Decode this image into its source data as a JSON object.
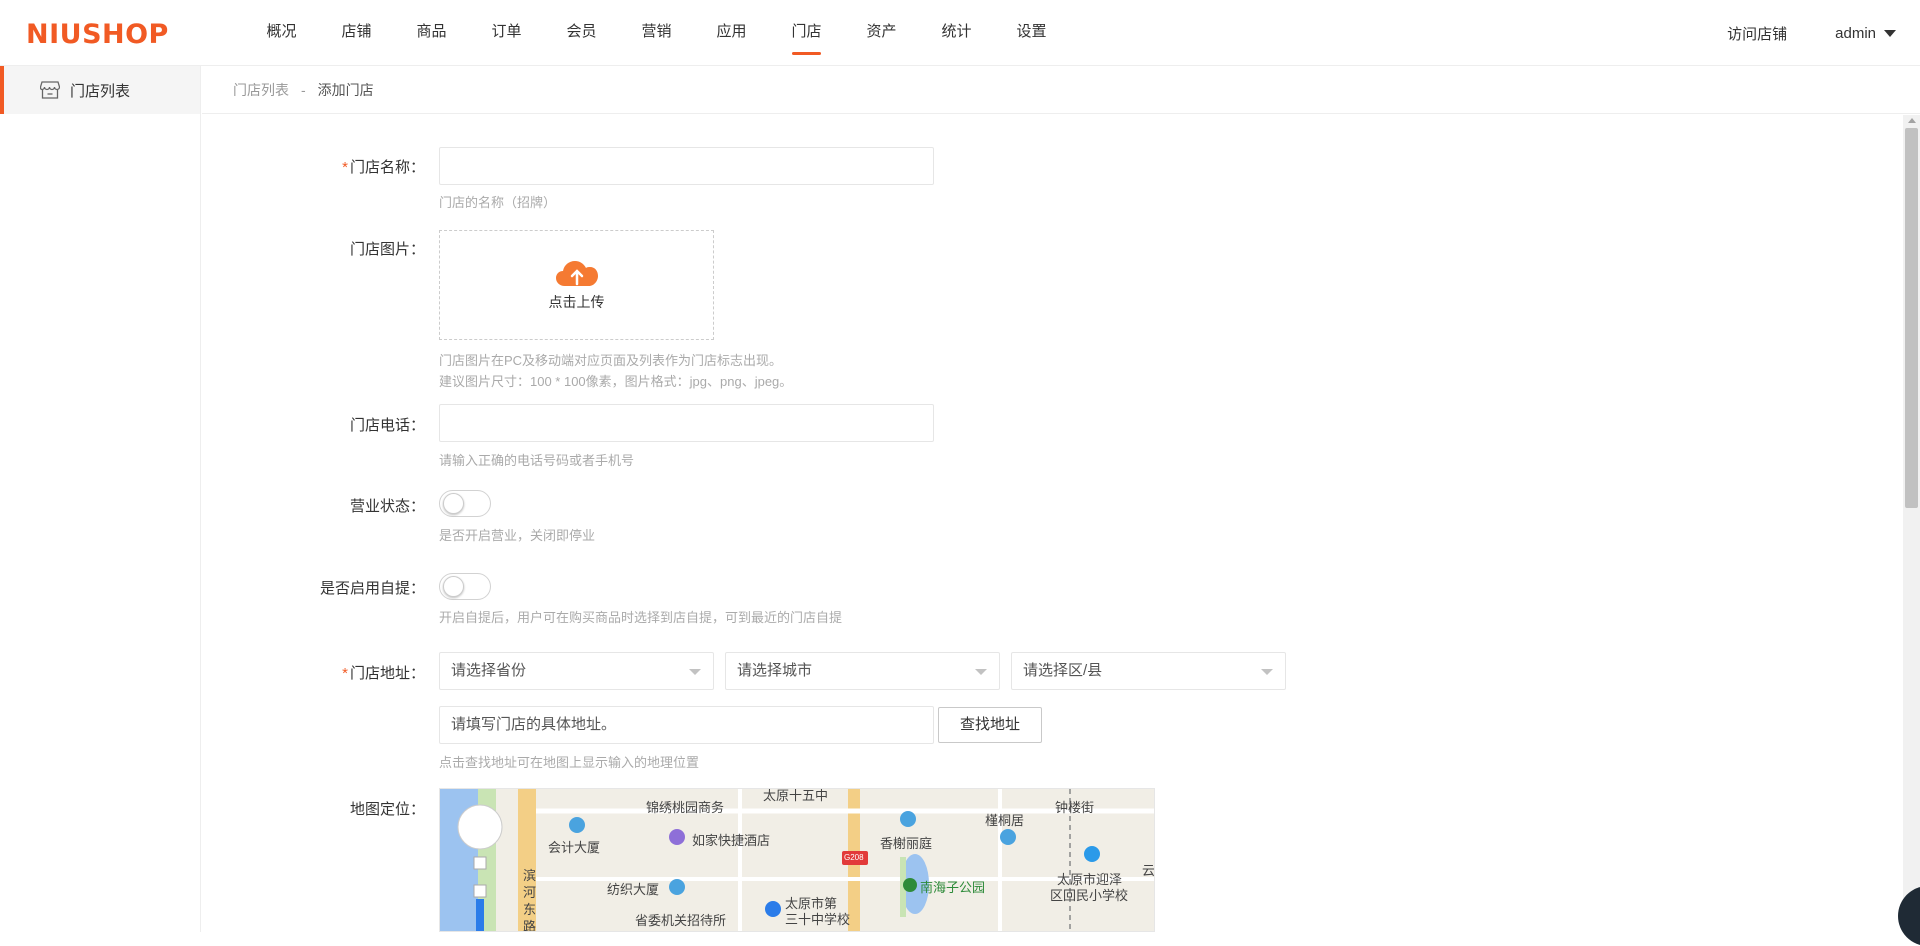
{
  "logo": "NIUSHOP",
  "nav": [
    "概况",
    "店铺",
    "商品",
    "订单",
    "会员",
    "营销",
    "应用",
    "门店",
    "资产",
    "统计",
    "设置"
  ],
  "nav_active": "门店",
  "header": {
    "visit_store": "访问店铺",
    "user": "admin"
  },
  "sidebar": {
    "items": [
      {
        "label": "门店列表",
        "icon": "store-icon"
      }
    ]
  },
  "breadcrumb": {
    "parent": "门店列表",
    "separator": "-",
    "current": "添加门店"
  },
  "form": {
    "name": {
      "label": "门店名称：",
      "value": "",
      "hint": "门店的名称（招牌）"
    },
    "image": {
      "label": "门店图片：",
      "upload_text": "点击上传",
      "hint1": "门店图片在PC及移动端对应页面及列表作为门店标志出现。",
      "hint2": "建议图片尺寸：100 * 100像素，图片格式：jpg、png、jpeg。"
    },
    "phone": {
      "label": "门店电话：",
      "value": "",
      "hint": "请输入正确的电话号码或者手机号"
    },
    "status": {
      "label": "营业状态：",
      "on": false,
      "hint": "是否开启营业，关闭即停业"
    },
    "pickup": {
      "label": "是否启用自提：",
      "on": false,
      "hint": "开启自提后，用户可在购买商品时选择到店自提，可到最近的门店自提"
    },
    "address": {
      "label": "门店地址：",
      "province_placeholder": "请选择省份",
      "city_placeholder": "请选择城市",
      "district_placeholder": "请选择区/县",
      "detail_placeholder": "请填写门店的具体地址。",
      "search_button": "查找地址",
      "hint": "点击查找地址可在地图上显示输入的地理位置"
    },
    "map": {
      "label": "地图定位：",
      "places": [
        "太原十五中",
        "锦绣桃园商务",
        "钟楼街",
        "槿桐居",
        "香榭丽庭",
        "会计大厦",
        "如家快捷酒店",
        "G208",
        "南海子公园",
        "太原市迎泽",
        "区回民小学校",
        "纺织大厦",
        "太原市第",
        "三十中学校",
        "省委机关招待所",
        "滨",
        "河",
        "东",
        "路",
        "云"
      ]
    }
  },
  "colors": {
    "accent": "#f15a24",
    "hint": "#aaaaaa",
    "border": "#e6e6e6"
  }
}
